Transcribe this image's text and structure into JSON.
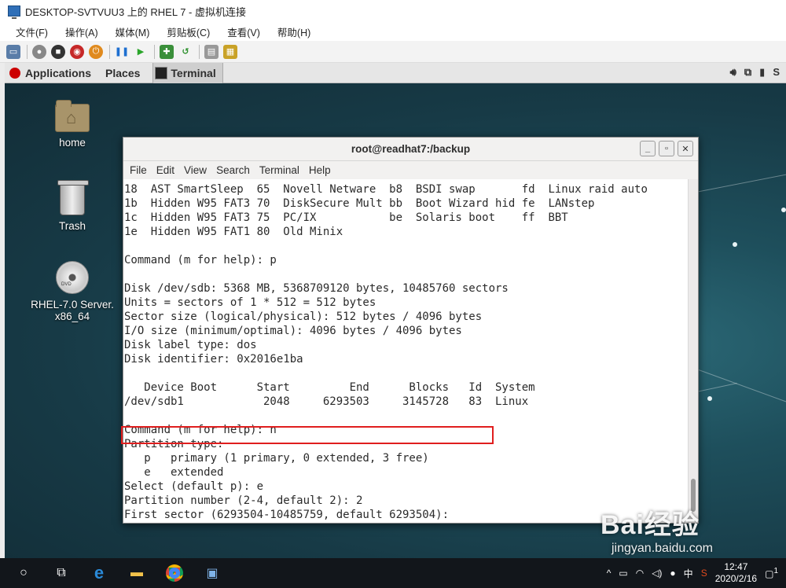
{
  "vm_window": {
    "title": "DESKTOP-SVTVUU3 上的 RHEL 7 - 虚拟机连接",
    "menu": [
      "文件(F)",
      "操作(A)",
      "媒体(M)",
      "剪贴板(C)",
      "查看(V)",
      "帮助(H)"
    ],
    "toolbar_icons": [
      "ctrl-alt-del-icon",
      "start-icon",
      "turn-off-icon",
      "shut-down-icon",
      "save-icon",
      "pause-icon",
      "resume-icon",
      "checkpoint-icon",
      "revert-icon",
      "enhanced-session-icon",
      "share-icon"
    ]
  },
  "gnome_panel": {
    "applications": "Applications",
    "places": "Places",
    "task_terminal": "Terminal",
    "tray": [
      "volume-icon",
      "network-icon",
      "battery-icon",
      "S"
    ]
  },
  "desktop_icons": [
    {
      "label": "home"
    },
    {
      "label": "Trash"
    },
    {
      "label_line1": "RHEL-7.0 Server.",
      "label_line2": "x86_64"
    }
  ],
  "terminal": {
    "title": "root@readhat7:/backup",
    "menu": [
      "File",
      "Edit",
      "View",
      "Search",
      "Terminal",
      "Help"
    ],
    "lines": [
      "18  AST SmartSleep  65  Novell Netware  b8  BSDI swap       fd  Linux raid auto",
      "1b  Hidden W95 FAT3 70  DiskSecure Mult bb  Boot Wizard hid fe  LANstep",
      "1c  Hidden W95 FAT3 75  PC/IX           be  Solaris boot    ff  BBT",
      "1e  Hidden W95 FAT1 80  Old Minix",
      "",
      "Command (m for help): p",
      "",
      "Disk /dev/sdb: 5368 MB, 5368709120 bytes, 10485760 sectors",
      "Units = sectors of 1 * 512 = 512 bytes",
      "Sector size (logical/physical): 512 bytes / 4096 bytes",
      "I/O size (minimum/optimal): 4096 bytes / 4096 bytes",
      "Disk label type: dos",
      "Disk identifier: 0x2016e1ba",
      "",
      "   Device Boot      Start         End      Blocks   Id  System",
      "/dev/sdb1            2048     6293503     3145728   83  Linux",
      "",
      "Command (m for help): n",
      "Partition type:",
      "   p   primary (1 primary, 0 extended, 3 free)",
      "   e   extended",
      "Select (default p): e",
      "Partition number (2-4, default 2): 2",
      "First sector (6293504-10485759, default 6293504):"
    ]
  },
  "watermark": {
    "brand": "Bai经验",
    "url": "jingyan.baidu.com"
  },
  "taskbar": {
    "icons": [
      "cortana-circle-icon",
      "task-view-icon",
      "edge-icon",
      "file-explorer-icon",
      "chrome-icon",
      "hyper-v-icon"
    ],
    "ime": "中",
    "time": "12:47",
    "date": "2020/2/16",
    "notification_count": "1"
  },
  "colors": {
    "highlight_border": "#e01e1e",
    "desktop_bg": "#1d3b48",
    "taskbar_bg": "#12161b"
  }
}
